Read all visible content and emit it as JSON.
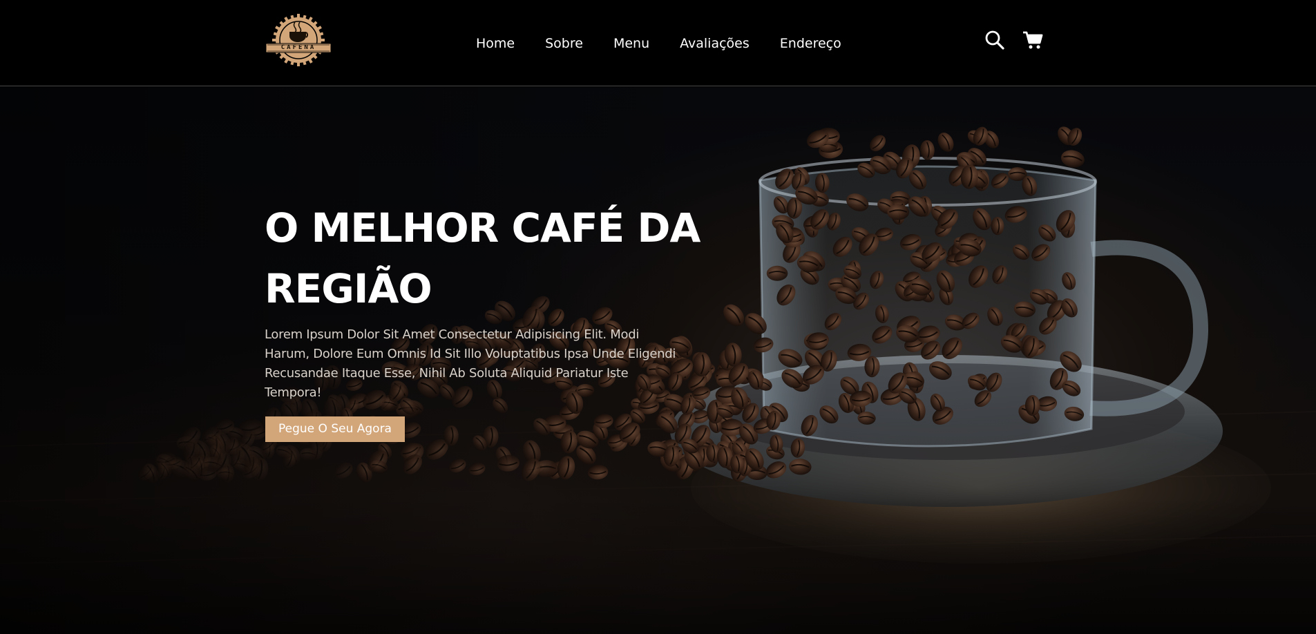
{
  "header": {
    "logo_text": "CAFENA",
    "nav": [
      {
        "label": "Home"
      },
      {
        "label": "Sobre"
      },
      {
        "label": "Menu"
      },
      {
        "label": "Avaliações"
      },
      {
        "label": "Endereço"
      }
    ],
    "icons": [
      "search-icon",
      "cart-icon"
    ]
  },
  "hero": {
    "title_line1": "O MELHOR CAFÉ DA",
    "title_line2": "REGIÃO",
    "description": "Lorem Ipsum Dolor Sit Amet Consectetur Adipisicing Elit. Modi Harum, Dolore Eum Omnis Id Sit Illo Voluptatibus Ipsa Unde Eligendi Recusandae Itaque Esse, Nihil Ab Soluta Aliquid Pariatur Iste Tempora!",
    "button_label": "Pegue O Seu Agora"
  },
  "colors": {
    "background": "#000000",
    "accent": "#d2a679",
    "text": "#ffffff"
  }
}
